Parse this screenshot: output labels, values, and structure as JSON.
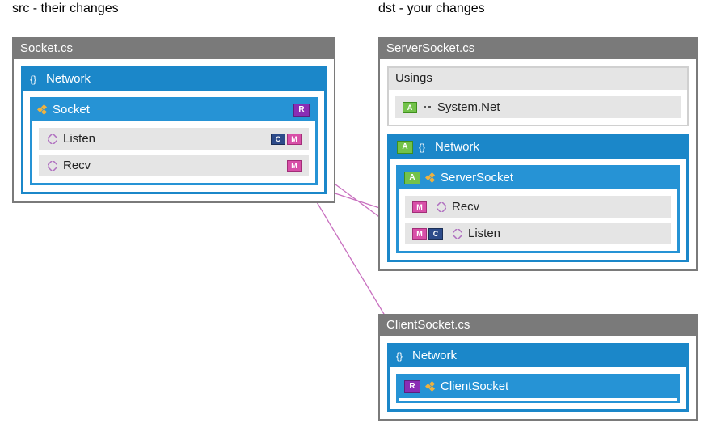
{
  "headers": {
    "src": "src - their changes",
    "dst": "dst - your changes"
  },
  "badges": {
    "A": "A",
    "R": "R",
    "M": "M",
    "C": "C"
  },
  "icons": {
    "namespace": "namespace-icon",
    "class": "class-icon",
    "method": "method-icon",
    "using": "using-icon"
  },
  "src": {
    "file": "Socket.cs",
    "namespace": "Network",
    "class": {
      "name": "Socket",
      "badge": "R"
    },
    "members": [
      {
        "name": "Listen",
        "badges": [
          "C",
          "M"
        ]
      },
      {
        "name": "Recv",
        "badges": [
          "M"
        ]
      }
    ]
  },
  "dst": {
    "serverFile": "ServerSocket.cs",
    "usingsLabel": "Usings",
    "usings": [
      {
        "name": "System.Net",
        "badge": "A"
      }
    ],
    "namespace": {
      "name": "Network",
      "badge": "A"
    },
    "class": {
      "name": "ServerSocket",
      "badge": "A"
    },
    "members": [
      {
        "name": "Recv",
        "badges": [
          "M"
        ]
      },
      {
        "name": "Listen",
        "badges": [
          "M",
          "C"
        ]
      }
    ],
    "clientFile": "ClientSocket.cs",
    "clientNamespace": "Network",
    "clientClass": {
      "name": "ClientSocket",
      "badge": "R"
    }
  }
}
